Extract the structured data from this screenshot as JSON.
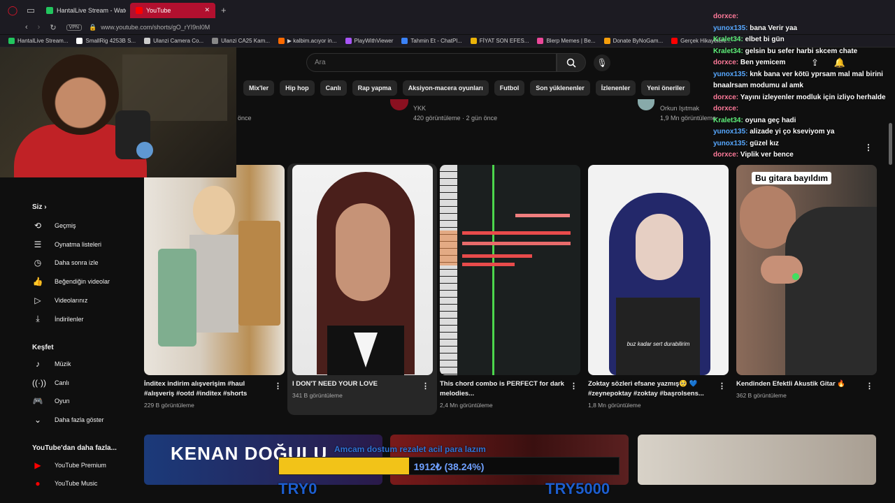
{
  "browser": {
    "tabs": [
      {
        "label": "HantalLive Stream - Watch",
        "active": false,
        "color": "#22c55e"
      },
      {
        "label": "YouTube",
        "active": true,
        "color": "#ff0000"
      }
    ],
    "url": "www.youtube.com/shorts/gO_rYI9nI0M",
    "vpn_label": "VPN",
    "bookmarks": [
      {
        "label": "HantalLive Stream...",
        "color": "#22c55e"
      },
      {
        "label": "SmallRig 4253B S...",
        "color": "#ffffff"
      },
      {
        "label": "Ulanzi Camera Co...",
        "color": "#cccccc"
      },
      {
        "label": "Ulanzi CA25 Kam...",
        "color": "#888888"
      },
      {
        "label": "▶ kalbim.acıyor in...",
        "color": "#ff6a00"
      },
      {
        "label": "PlayWithViewer",
        "color": "#a855f7"
      },
      {
        "label": "Tahmin Et - ChatPl...",
        "color": "#3b82f6"
      },
      {
        "label": "FİYAT SON EFES...",
        "color": "#eab308"
      },
      {
        "label": "Blerp Memes | Be...",
        "color": "#ec4899"
      },
      {
        "label": "Donate ByNoGam...",
        "color": "#f59e0b"
      },
      {
        "label": "Gerçek Hikayelere...",
        "color": "#ff0000"
      }
    ]
  },
  "youtube": {
    "search_placeholder": "Ara",
    "chips": [
      "Mix'ler",
      "Hip hop",
      "Canlı",
      "Rap yapma",
      "Aksiyon-macera oyunları",
      "Futbol",
      "Son yüklenenler",
      "İzlenenler",
      "Yeni öneriler"
    ],
    "previous_row": {
      "left_time": "önce",
      "mid_channel": "YKK",
      "mid_meta": "420 görüntüleme · 2 gün önce",
      "right_channel": "Orkun Işıtmak",
      "right_meta": "1,9 Mn görüntüleme"
    },
    "sidebar": {
      "you_label": "Siz",
      "you_items": [
        "Geçmiş",
        "Oynatma listeleri",
        "Daha sonra izle",
        "Beğendiğin videolar",
        "Videolarınız",
        "İndirilenler"
      ],
      "explore_label": "Keşfet",
      "explore_items": [
        "Müzik",
        "Canlı",
        "Oyun"
      ],
      "more_label": "Daha fazla göster",
      "more_from_label": "YouTube'dan daha fazla...",
      "more_from_items": [
        "YouTube Premium",
        "YouTube Music"
      ]
    },
    "shorts": [
      {
        "title": "İnditex indirim alışverişim #haul #alışveriş #ootd #inditex #shorts",
        "views": "229 B görüntüleme"
      },
      {
        "title": "I DON'T NEED YOUR LOVE",
        "views": "341 B görüntüleme"
      },
      {
        "title": "This chord combo is PERFECT for dark melodies...",
        "views": "2,4 Mn görüntüleme"
      },
      {
        "title": "Zoktay sözleri efsane yazmış🥺 💙 #zeynepoktay #zoktay #başrolsens...",
        "views": "1,8 Mn görüntüleme",
        "caption": "buz kadar sert durabilirim"
      },
      {
        "title": "Kendinden Efektli Akustik Gitar 🔥",
        "views": "362 B görüntüleme",
        "caption": "Bu gitara bayıldım"
      }
    ],
    "bottom_thumb_text": "KENAN DOĞULU"
  },
  "overlay": {
    "chat": [
      {
        "user": "dorxce:",
        "msg": "",
        "color": "u1"
      },
      {
        "user": "yunox135:",
        "msg": "bana Verir yaa",
        "color": "u2"
      },
      {
        "user": "Kralet34:",
        "msg": "elbet bi gün",
        "color": "u3"
      },
      {
        "user": "Kralet34:",
        "msg": "gelsin bu sefer harbi skcem chate",
        "color": "u3"
      },
      {
        "user": "dorxce:",
        "msg": "Ben yemicem",
        "color": "u1"
      },
      {
        "user": "yunox135:",
        "msg": "knk bana ver kötü yprsam mal mal birini bnaalrsam modumu al amk",
        "color": "u2"
      },
      {
        "user": "dorxce:",
        "msg": "Yayını izleyenler modluk için izliyo herhalde",
        "color": "u1"
      },
      {
        "user": "dorxce:",
        "msg": "",
        "color": "u1"
      },
      {
        "user": "Kralet34:",
        "msg": "oyuna geç hadi",
        "color": "u3"
      },
      {
        "user": "yunox135:",
        "msg": "alizade yi ço kseviyom ya",
        "color": "u2"
      },
      {
        "user": "yunox135:",
        "msg": "güzel kız",
        "color": "u2"
      },
      {
        "user": "dorxce:",
        "msg": "Viplik ver bence",
        "color": "u1"
      }
    ],
    "goal_title": "Amcam dostum rezalet acil para lazım",
    "goal_amount": "1912₺ (38.24%)",
    "goal_fraction": 0.3824,
    "goal_start": "TRY0",
    "goal_end": "TRY5000"
  }
}
